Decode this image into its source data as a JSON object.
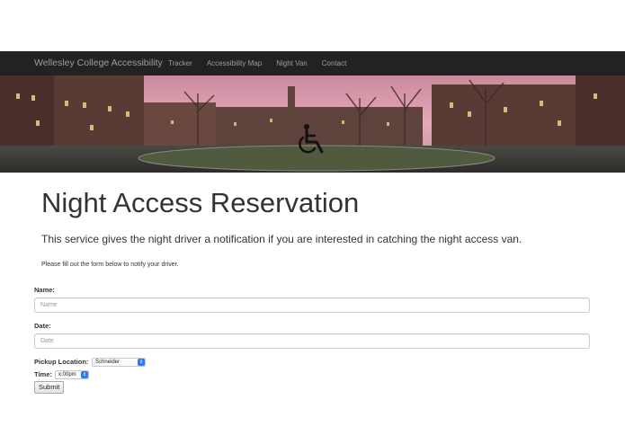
{
  "nav": {
    "brand": "Wellesley College Accessibility",
    "links": [
      "Tracker",
      "Accessibility Map",
      "Night Van",
      "Contact"
    ]
  },
  "hero": {
    "image": "campus-panorama-at-dusk",
    "icon": "wheelchair-icon"
  },
  "page": {
    "title": "Night Access Reservation",
    "lead": "This service gives the night driver a notification if you are interested in catching the night access van.",
    "note": "Please fill out the form below to notify your driver."
  },
  "form": {
    "name_label": "Name:",
    "name_placeholder": "Name",
    "date_label": "Date:",
    "date_placeholder": "Date",
    "pickup_label": "Pickup Location:",
    "pickup_value": "Schneider",
    "time_label": "Time:",
    "time_value": "x:00pm",
    "submit_label": "Submit"
  },
  "colors": {
    "navbar_bg": "#222222",
    "nav_text": "#9d9d9d",
    "select_arrow": "#2d7cf4"
  }
}
